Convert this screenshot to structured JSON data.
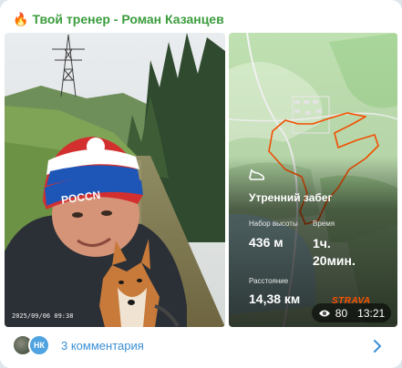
{
  "post": {
    "channel_title": "Твой тренер - Роман Казанцев",
    "channel_icon": "fire-icon",
    "photo_date": "2025/09/06 09:38"
  },
  "strava": {
    "title": "Утренний забег",
    "elevation_label": "Набор высоты",
    "elevation_value": "436 м",
    "time_label": "Время",
    "time_value_line1": "1ч.",
    "time_value_line2": "20мин.",
    "distance_label": "Расстояние",
    "distance_value": "14,38 км",
    "logo": "STRAVA",
    "route_color": "#fc5200"
  },
  "footer": {
    "views": "80",
    "time": "13:21",
    "avatar_initials": "НК",
    "comments_label": "3 комментария",
    "accent_color": "#3a8fd6"
  }
}
